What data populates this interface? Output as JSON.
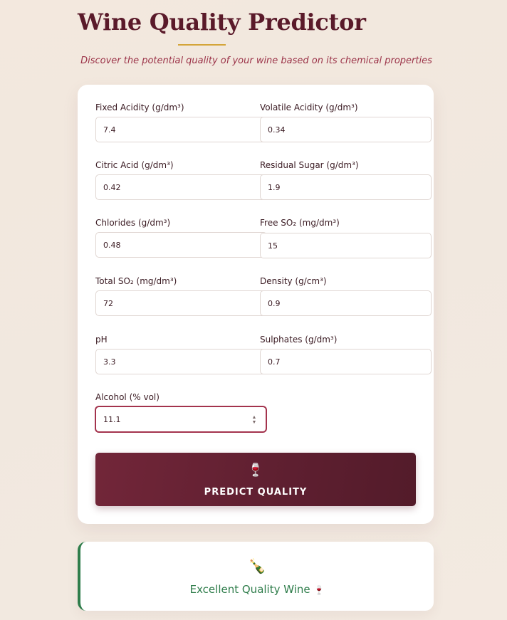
{
  "header": {
    "title": "Wine Quality Predictor",
    "subtitle": "Discover the potential quality of your wine based on its chemical properties"
  },
  "form": {
    "fields": [
      {
        "label": "Fixed Acidity (g/dm³)",
        "value": "7.4"
      },
      {
        "label": "Volatile Acidity (g/dm³)",
        "value": "0.34"
      },
      {
        "label": "Citric Acid (g/dm³)",
        "value": "0.42"
      },
      {
        "label": "Residual Sugar (g/dm³)",
        "value": "1.9"
      },
      {
        "label": "Chlorides (g/dm³)",
        "value": "0.48"
      },
      {
        "label": "Free SO₂ (mg/dm³)",
        "value": "15"
      },
      {
        "label": "Total SO₂ (mg/dm³)",
        "value": "72"
      },
      {
        "label": "Density (g/cm³)",
        "value": "0.9"
      },
      {
        "label": "pH",
        "value": "3.3"
      },
      {
        "label": "Sulphates (g/dm³)",
        "value": "0.7"
      },
      {
        "label": "Alcohol (% vol)",
        "value": "11.1"
      }
    ],
    "focused_field": "Alcohol (% vol)"
  },
  "predict_button": {
    "icon": "wine-glass-icon",
    "icon_glyph": "🍷",
    "label": "PREDICT QUALITY"
  },
  "result": {
    "icon": "champagne-bottle-icon",
    "icon_glyph": "🍾",
    "text": "Excellent Quality Wine",
    "trailing_icon_glyph": "🍷"
  },
  "colors": {
    "brand": "#5a1a2a",
    "accent_gold": "#d4a53a",
    "subtitle": "#9b3348",
    "button": "#6a2235",
    "success": "#2f7d4b"
  }
}
